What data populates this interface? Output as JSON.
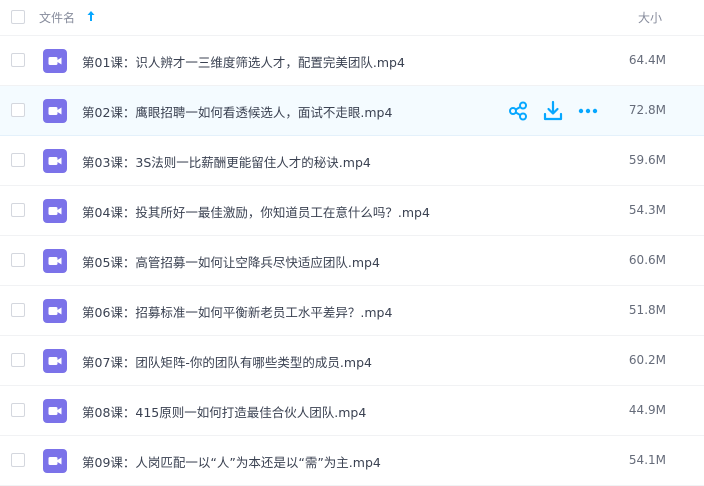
{
  "header": {
    "name_label": "文件名",
    "size_label": "大小"
  },
  "files": [
    {
      "name": "第01课：识人辨才一三维度筛选人才，配置完美团队.mp4",
      "size": "64.4M"
    },
    {
      "name": "第02课：鹰眼招聘一如何看透候选人，面试不走眼.mp4",
      "size": "72.8M"
    },
    {
      "name": "第03课：3S法则一比薪酬更能留住人才的秘诀.mp4",
      "size": "59.6M"
    },
    {
      "name": "第04课：投其所好一最佳激励，你知道员工在意什么吗？.mp4",
      "size": "54.3M"
    },
    {
      "name": "第05课：高管招募一如何让空降兵尽快适应团队.mp4",
      "size": "60.6M"
    },
    {
      "name": "第06课：招募标准一如何平衡新老员工水平差异？.mp4",
      "size": "51.8M"
    },
    {
      "name": "第07课：团队矩阵-你的团队有哪些类型的成员.mp4",
      "size": "60.2M"
    },
    {
      "name": "第08课：415原则一如何打造最佳合伙人团队.mp4",
      "size": "44.9M"
    },
    {
      "name": "第09课：人岗匹配一以“人”为本还是以“需”为主.mp4",
      "size": "54.1M"
    }
  ],
  "colors": {
    "video_icon": "#7b72e9",
    "accent": "#06a7ff"
  },
  "icons": {
    "file": "video-file-icon",
    "share": "share-icon",
    "download": "download-icon",
    "more": "more-icon",
    "sort": "sort-ascending-arrow-icon"
  }
}
